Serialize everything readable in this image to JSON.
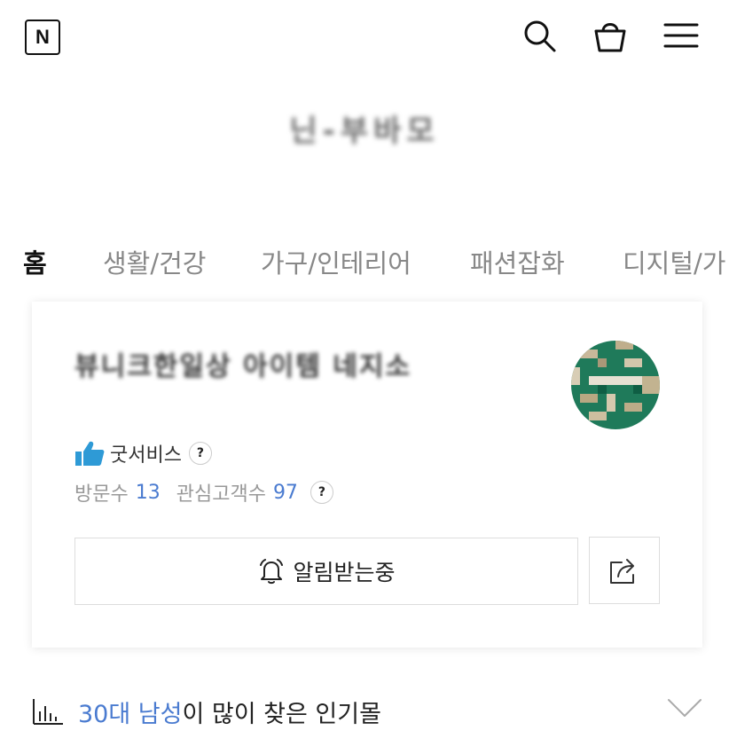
{
  "header": {
    "logo_letter": "N",
    "icons": [
      "search-icon",
      "shopping-bag-icon",
      "menu-icon"
    ]
  },
  "store": {
    "title": "닌-부바모"
  },
  "tabs": [
    {
      "label": "홈",
      "active": true
    },
    {
      "label": "생활/건강",
      "active": false
    },
    {
      "label": "가구/인테리어",
      "active": false
    },
    {
      "label": "패션잡화",
      "active": false
    },
    {
      "label": "디지털/가",
      "active": false
    }
  ],
  "card": {
    "shop_name": "뷰니크한일상 아이템 네지소",
    "badge_label": "굿서비스",
    "help_mark": "?",
    "visits_label": "방문수",
    "visits_value": "13",
    "followers_label": "관심고객수",
    "followers_value": "97",
    "notify_label": "알림받는중",
    "share_icon": "share-icon",
    "accent_color": "#4a7bd0",
    "thumb_color": "#2e9ad6"
  },
  "popular": {
    "highlight": "30대 남성",
    "suffix": "이 많이 찾은 인기몰"
  }
}
